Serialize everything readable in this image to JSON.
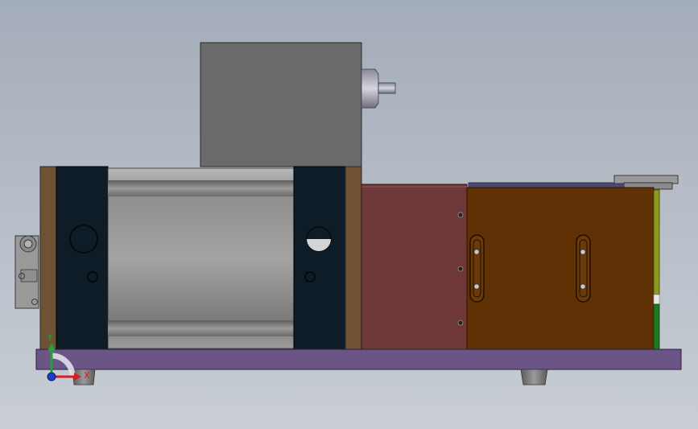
{
  "viewport": {
    "background_top": "#a3acb9",
    "background_bottom": "#c9ced5"
  },
  "axis_triad": {
    "y_label": "Y",
    "x_label": "X",
    "y_color": "#1fa33a",
    "x_color": "#d32020",
    "z_color": "#1f3cc8"
  },
  "colors": {
    "motor": "#6a6a6a",
    "base_plate": "#6b5587",
    "end_block": "#0d1c26",
    "brown_plate": "#6e5233",
    "red_box": "#6e3839",
    "orange_box": "#5f3104",
    "green_strip": "#1e7a1e",
    "olive_strip": "#8c9a20"
  }
}
